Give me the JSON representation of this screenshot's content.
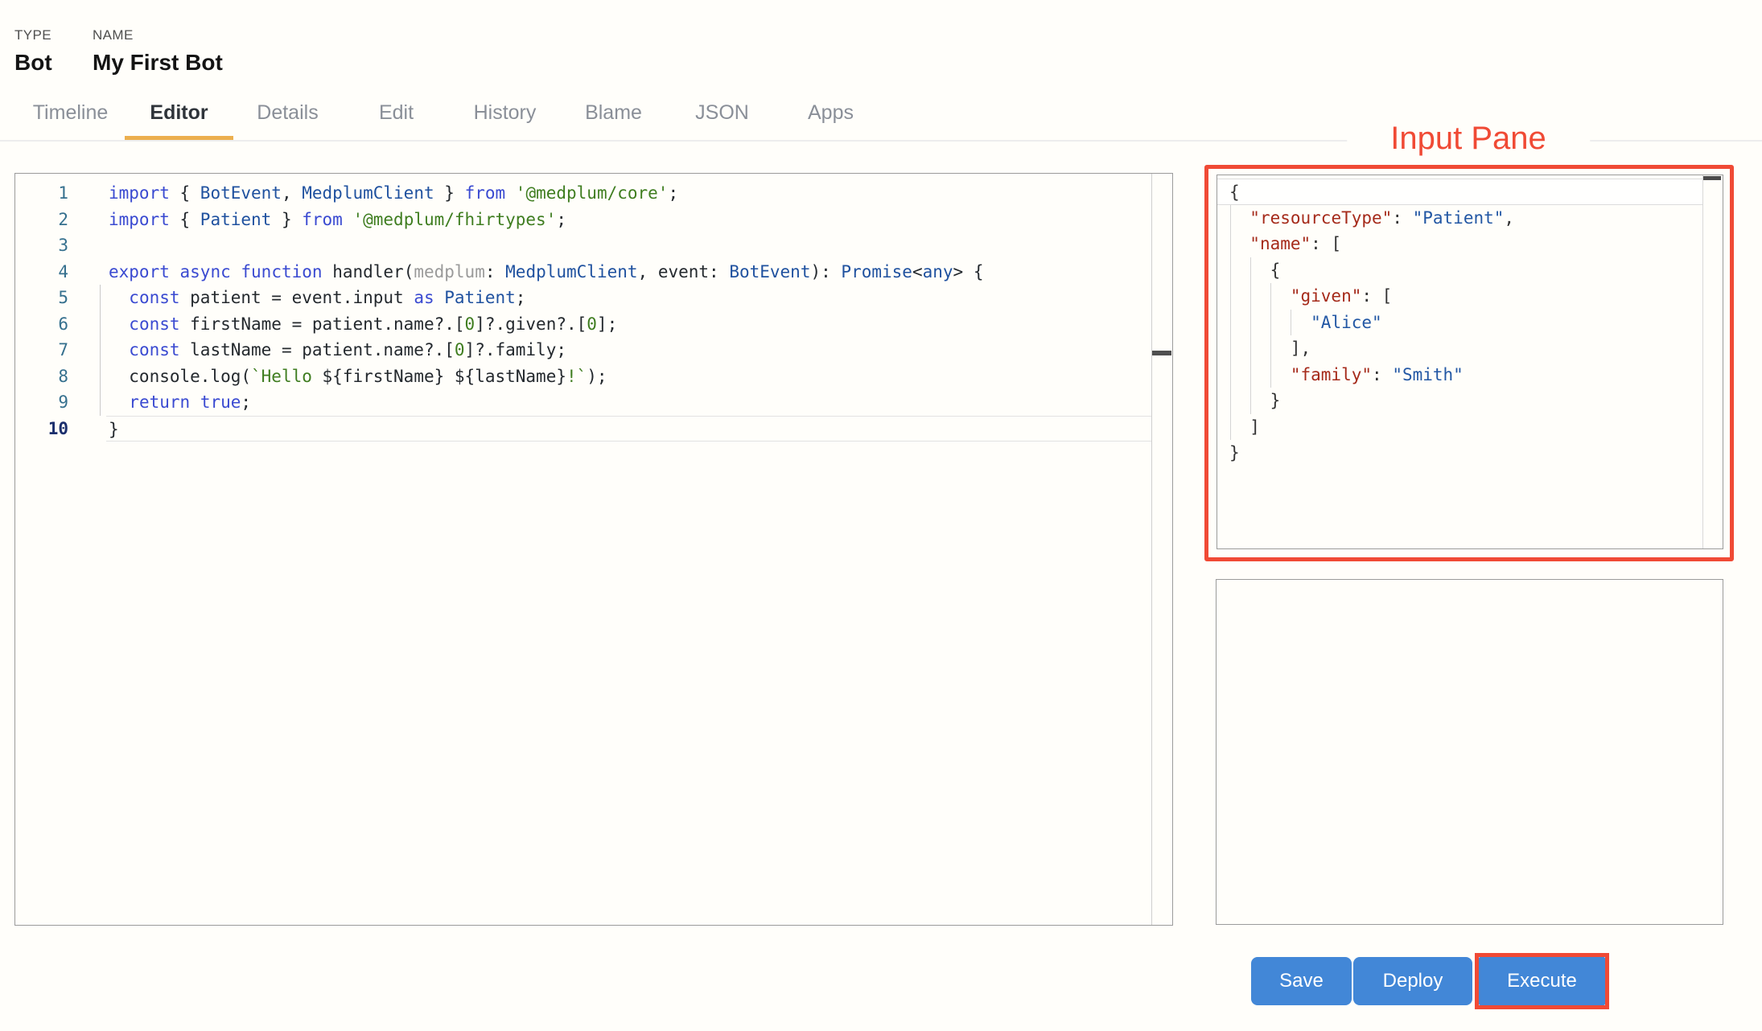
{
  "header": {
    "type_label": "TYPE",
    "type_value": "Bot",
    "name_label": "NAME",
    "name_value": "My First Bot"
  },
  "tabs": {
    "items": [
      {
        "label": "Timeline",
        "active": false
      },
      {
        "label": "Editor",
        "active": true
      },
      {
        "label": "Details",
        "active": false
      },
      {
        "label": "Edit",
        "active": false
      },
      {
        "label": "History",
        "active": false
      },
      {
        "label": "Blame",
        "active": false
      },
      {
        "label": "JSON",
        "active": false
      },
      {
        "label": "Apps",
        "active": false
      }
    ]
  },
  "annotation": {
    "input_pane_label": "Input Pane",
    "annotation_color": "#f04a35",
    "highlighted_button": "Execute"
  },
  "editor": {
    "active_line": 10,
    "lines": [
      [
        [
          "kw",
          "import"
        ],
        [
          "pl",
          " { "
        ],
        [
          "ty",
          "BotEvent"
        ],
        [
          "pl",
          ", "
        ],
        [
          "ty",
          "MedplumClient"
        ],
        [
          "pl",
          " } "
        ],
        [
          "kw",
          "from"
        ],
        [
          "pl",
          " "
        ],
        [
          "st",
          "'@medplum/core'"
        ],
        [
          "pl",
          ";"
        ]
      ],
      [
        [
          "kw",
          "import"
        ],
        [
          "pl",
          " { "
        ],
        [
          "ty",
          "Patient"
        ],
        [
          "pl",
          " } "
        ],
        [
          "kw",
          "from"
        ],
        [
          "pl",
          " "
        ],
        [
          "st",
          "'@medplum/fhirtypes'"
        ],
        [
          "pl",
          ";"
        ]
      ],
      [],
      [
        [
          "kw",
          "export"
        ],
        [
          "pl",
          " "
        ],
        [
          "kw",
          "async"
        ],
        [
          "pl",
          " "
        ],
        [
          "kw",
          "function"
        ],
        [
          "pl",
          " handler("
        ],
        [
          "var",
          "medplum"
        ],
        [
          "pl",
          ": "
        ],
        [
          "ty",
          "MedplumClient"
        ],
        [
          "pl",
          ", event: "
        ],
        [
          "ty",
          "BotEvent"
        ],
        [
          "pl",
          "): "
        ],
        [
          "ty",
          "Promise"
        ],
        [
          "pl",
          "<"
        ],
        [
          "ty",
          "any"
        ],
        [
          "pl",
          "> {"
        ]
      ],
      [
        [
          "pl",
          "  "
        ],
        [
          "kw",
          "const"
        ],
        [
          "pl",
          " patient = event.input "
        ],
        [
          "kw",
          "as"
        ],
        [
          "pl",
          " "
        ],
        [
          "ty",
          "Patient"
        ],
        [
          "pl",
          ";"
        ]
      ],
      [
        [
          "pl",
          "  "
        ],
        [
          "kw",
          "const"
        ],
        [
          "pl",
          " firstName = patient.name?.["
        ],
        [
          "num",
          "0"
        ],
        [
          "pl",
          "]?.given?.["
        ],
        [
          "num",
          "0"
        ],
        [
          "pl",
          "];"
        ]
      ],
      [
        [
          "pl",
          "  "
        ],
        [
          "kw",
          "const"
        ],
        [
          "pl",
          " lastName = patient.name?.["
        ],
        [
          "num",
          "0"
        ],
        [
          "pl",
          "]?.family;"
        ]
      ],
      [
        [
          "pl",
          "  console.log("
        ],
        [
          "st",
          "`Hello "
        ],
        [
          "pl",
          "${firstName}"
        ],
        [
          "st",
          " "
        ],
        [
          "pl",
          "${lastName}"
        ],
        [
          "st",
          "!`"
        ],
        [
          "pl",
          ");"
        ]
      ],
      [
        [
          "pl",
          "  "
        ],
        [
          "kw",
          "return"
        ],
        [
          "pl",
          " "
        ],
        [
          "kw",
          "true"
        ],
        [
          "pl",
          ";"
        ]
      ],
      [
        [
          "pl",
          "}"
        ]
      ]
    ]
  },
  "input_pane": {
    "active_line": 1,
    "lines": [
      [
        [
          "jp",
          "{"
        ]
      ],
      [
        [
          "jp",
          "  "
        ],
        [
          "jk",
          "\"resourceType\""
        ],
        [
          "jp",
          ": "
        ],
        [
          "jv",
          "\"Patient\""
        ],
        [
          "jp",
          ","
        ]
      ],
      [
        [
          "jp",
          "  "
        ],
        [
          "jk",
          "\"name\""
        ],
        [
          "jp",
          ": ["
        ]
      ],
      [
        [
          "jp",
          "    {"
        ]
      ],
      [
        [
          "jp",
          "      "
        ],
        [
          "jk",
          "\"given\""
        ],
        [
          "jp",
          ": ["
        ]
      ],
      [
        [
          "jp",
          "        "
        ],
        [
          "jv",
          "\"Alice\""
        ]
      ],
      [
        [
          "jp",
          "      ],"
        ]
      ],
      [
        [
          "jp",
          "      "
        ],
        [
          "jk",
          "\"family\""
        ],
        [
          "jp",
          ": "
        ],
        [
          "jv",
          "\"Smith\""
        ]
      ],
      [
        [
          "jp",
          "    }"
        ]
      ],
      [
        [
          "jp",
          "  ]"
        ]
      ],
      [
        [
          "jp",
          "}"
        ]
      ]
    ]
  },
  "actions": {
    "save_label": "Save",
    "deploy_label": "Deploy",
    "execute_label": "Execute"
  },
  "colors": {
    "button_blue": "#4287d7",
    "tab_underline_amber": "#ecaf4e",
    "annotation_red": "#f04a35"
  }
}
